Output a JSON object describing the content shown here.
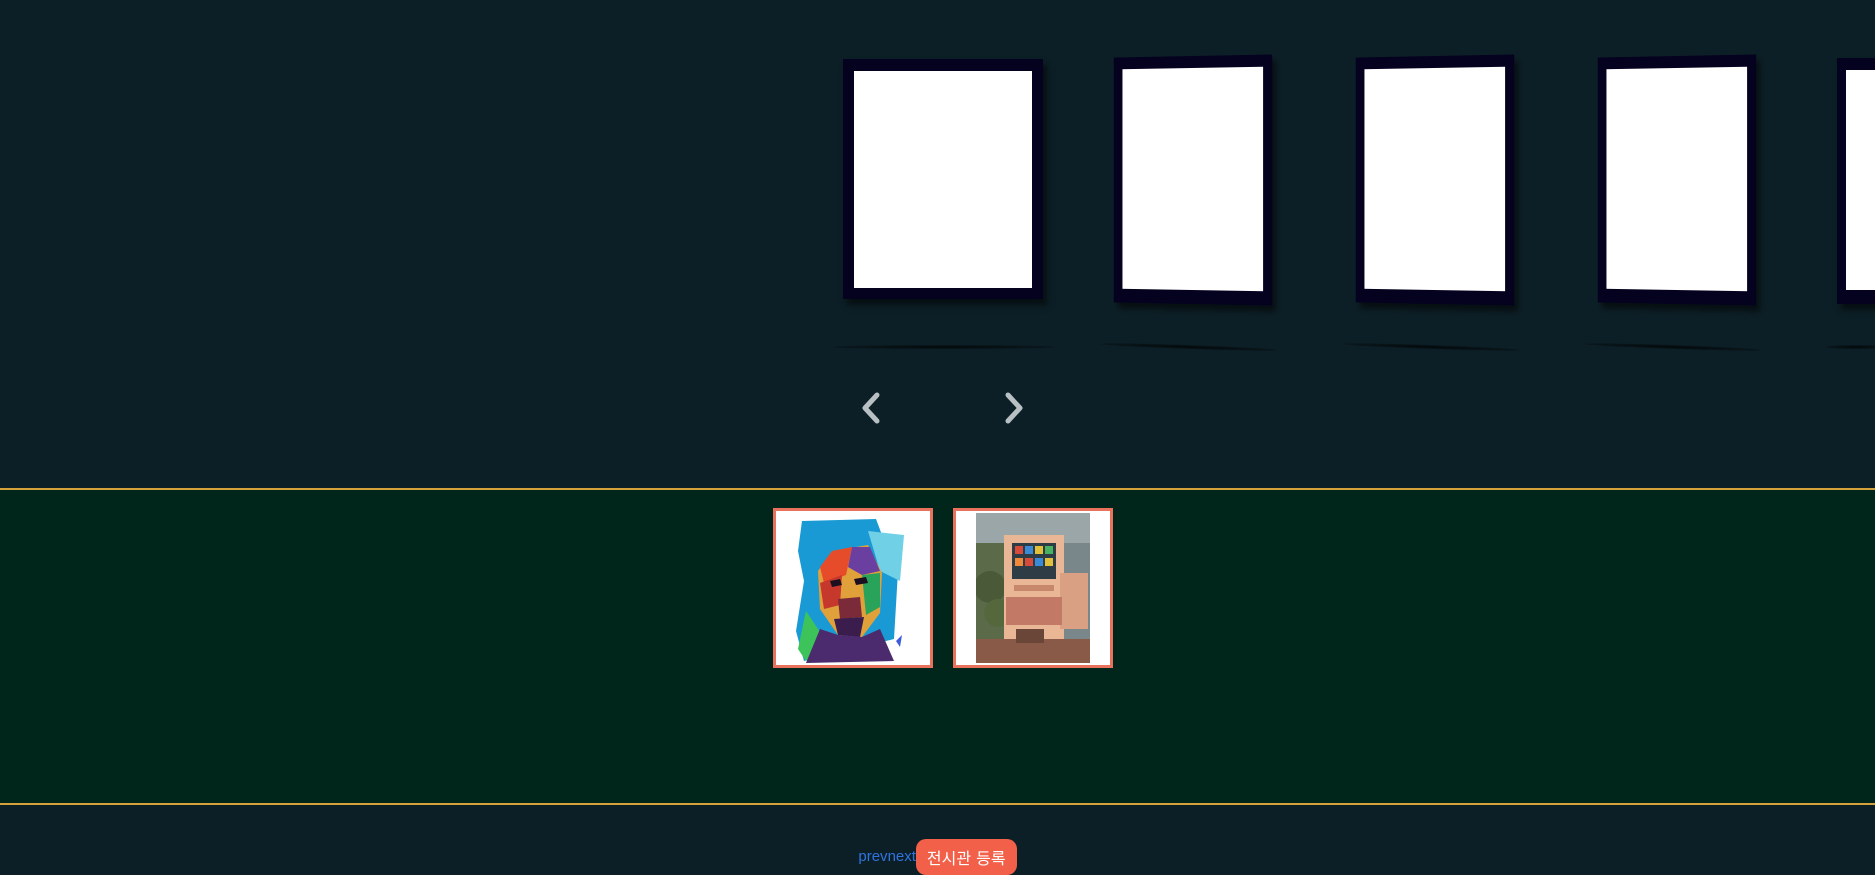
{
  "gallery": {
    "nav": {
      "prev_icon": "chevron-left-icon",
      "next_icon": "chevron-right-icon"
    }
  },
  "thumbnails": [
    {
      "name": "pop-art-portrait",
      "icon": "portrait-image"
    },
    {
      "name": "vending-machine-photo",
      "icon": "photo-image"
    }
  ],
  "footer": {
    "prev_label": "prev",
    "next_label": "next",
    "register_label": "전시관 등록"
  },
  "colors": {
    "background": "#0c1f26",
    "strip_background": "#00251b",
    "strip_border": "#d7a13a",
    "thumb_border": "#e8725c",
    "frame": "#04021f",
    "link": "#2f73e0",
    "button": "#f2604a"
  }
}
